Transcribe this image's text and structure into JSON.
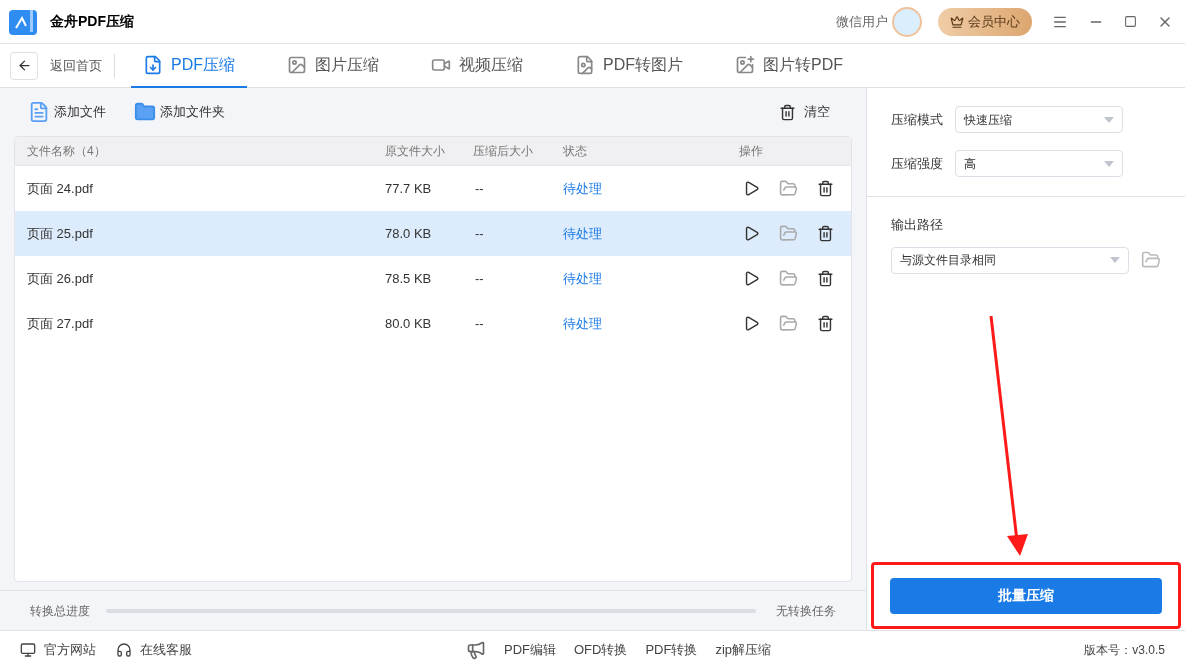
{
  "window": {
    "title": "金舟PDF压缩",
    "user": "微信用户",
    "vip_button": "会员中心"
  },
  "nav": {
    "back": "返回首页",
    "tabs": [
      {
        "label": "PDF压缩",
        "selected": true,
        "kind": "pdf"
      },
      {
        "label": "图片压缩",
        "selected": false,
        "kind": "image"
      },
      {
        "label": "视频压缩",
        "selected": false,
        "kind": "video"
      },
      {
        "label": "PDF转图片",
        "selected": false,
        "kind": "pdf2img"
      },
      {
        "label": "图片转PDF",
        "selected": false,
        "kind": "img2pdf"
      }
    ]
  },
  "toolbar": {
    "add_file": "添加文件",
    "add_folder": "添加文件夹",
    "clear": "清空"
  },
  "table": {
    "columns": [
      "文件名称（4）",
      "原文件大小",
      "压缩后大小",
      "状态",
      "操作"
    ],
    "rows": [
      {
        "name": "页面 24.pdf",
        "size": "77.7 KB",
        "compressed": "--",
        "status": "待处理",
        "selected": false
      },
      {
        "name": "页面 25.pdf",
        "size": "78.0 KB",
        "compressed": "--",
        "status": "待处理",
        "selected": true
      },
      {
        "name": "页面 26.pdf",
        "size": "78.5 KB",
        "compressed": "--",
        "status": "待处理",
        "selected": false
      },
      {
        "name": "页面 27.pdf",
        "size": "80.0 KB",
        "compressed": "--",
        "status": "待处理",
        "selected": false
      }
    ]
  },
  "progress": {
    "label": "转换总进度",
    "level": 0,
    "reading": "无转换任务"
  },
  "settings": {
    "mode_label": "压缩模式",
    "mode_value": "快速压缩",
    "strength_label": "压缩强度",
    "strength_value": "高",
    "output_label": "输出路径",
    "output_value": "与源文件目录相同",
    "start_button": "批量压缩"
  },
  "footer": {
    "links": [
      "官方网站",
      "在线客服"
    ],
    "tools": [
      "PDF编辑",
      "OFD转换",
      "PDF转换",
      "zip解压缩"
    ],
    "version": "版本号：v3.0.5"
  }
}
